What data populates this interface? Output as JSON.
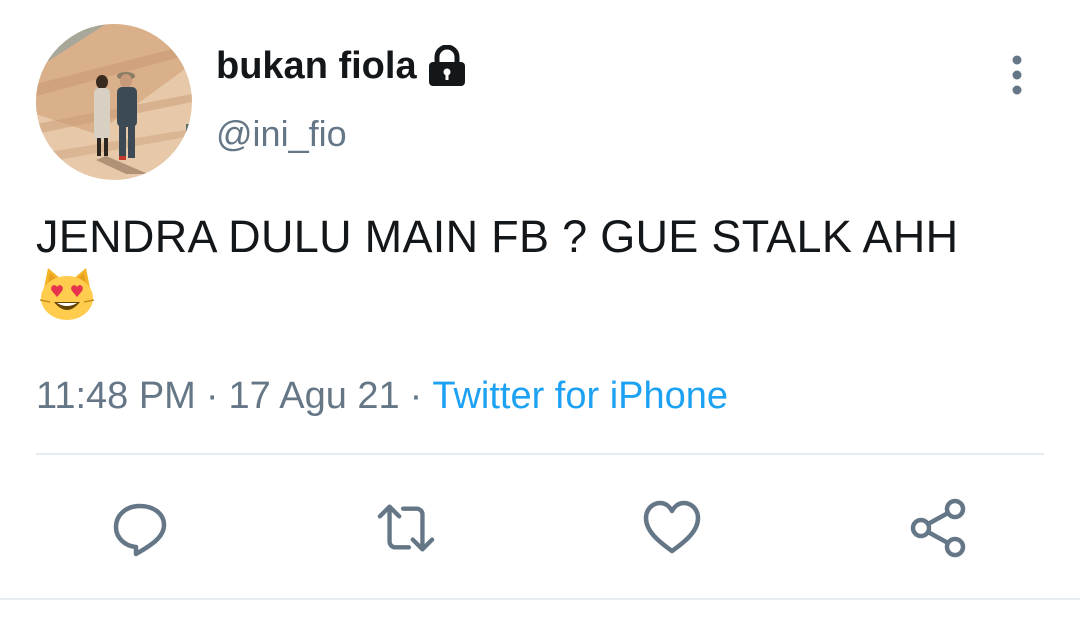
{
  "author": {
    "display_name": "bukan fiola",
    "handle": "@ini_fio",
    "protected_icon": "lock-icon",
    "avatar": "profile-photo"
  },
  "tweet": {
    "text": "JENDRA DULU MAIN FB ? GUE STALK AHH",
    "emoji": "smiling-cat-with-heart-eyes"
  },
  "meta": {
    "time": "11:48 PM",
    "separator": "·",
    "date": "17 Agu 21",
    "source": "Twitter for iPhone"
  },
  "actions": {
    "icons": [
      "reply-icon",
      "retweet-icon",
      "like-icon",
      "share-icon"
    ]
  },
  "colors": {
    "text": "#14171a",
    "secondary": "#657786",
    "link": "#1da1f2",
    "divider": "#e6ecf0"
  }
}
